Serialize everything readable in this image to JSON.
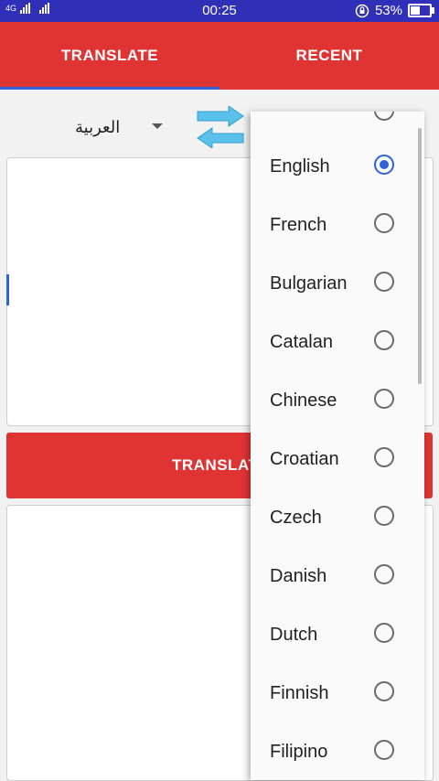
{
  "status_bar": {
    "network_label": "4G",
    "time": "00:25",
    "battery": "53%",
    "battery_level": 0.53,
    "icons": [
      "signal-icon",
      "rotation-lock-icon",
      "battery-icon"
    ]
  },
  "tabs": [
    {
      "label": "TRANSLATE",
      "selected": true
    },
    {
      "label": "RECENT",
      "selected": false
    }
  ],
  "source_language": "العربية",
  "translate_button_label": "TRANSLATE",
  "language_options": [
    {
      "label": "English",
      "selected": true
    },
    {
      "label": "French",
      "selected": false
    },
    {
      "label": "Bulgarian",
      "selected": false
    },
    {
      "label": "Catalan",
      "selected": false
    },
    {
      "label": "Chinese",
      "selected": false
    },
    {
      "label": "Croatian",
      "selected": false
    },
    {
      "label": "Czech",
      "selected": false
    },
    {
      "label": "Danish",
      "selected": false
    },
    {
      "label": "Dutch",
      "selected": false
    },
    {
      "label": "Finnish",
      "selected": false
    },
    {
      "label": "Filipino",
      "selected": false
    }
  ],
  "colors": {
    "status_bar": "#2f2fb8",
    "accent_red": "#e03434",
    "accent_blue": "#2f63d9"
  }
}
